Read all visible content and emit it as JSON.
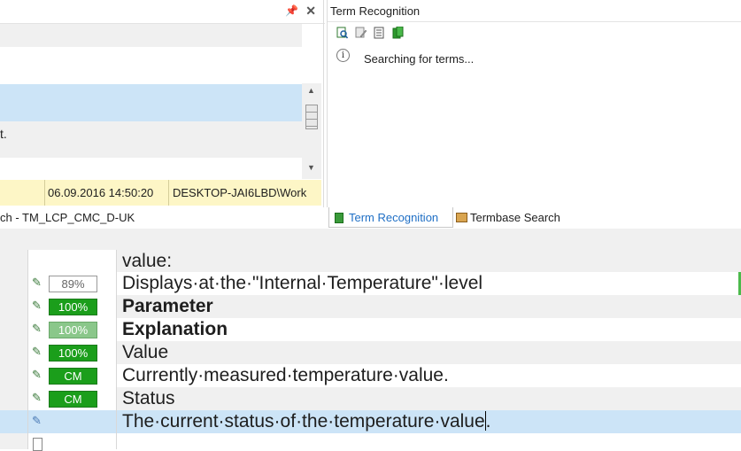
{
  "left_panel": {
    "pin_glyph": "📌",
    "close_glyph": "✕",
    "row_fragment": "t.",
    "status_row": {
      "date": "06.09.2016 14:50:20",
      "user": "DESKTOP-JAI6LBD\\Work"
    }
  },
  "term_recognition_panel": {
    "title": "Term Recognition",
    "toolbar_icons": [
      "search-term-icon",
      "edit-term-icon",
      "term-settings-icon",
      "termbase-icon"
    ],
    "info_glyph": "i",
    "message": "Searching for terms..."
  },
  "tabs": {
    "tm_label": "ch - TM_LCP_CMC_D-UK",
    "term_recognition": "Term Recognition",
    "termbase_search": "Termbase Search"
  },
  "editor": {
    "rows": [
      {
        "status": "",
        "target": "value:",
        "bold": false
      },
      {
        "status": "89%",
        "target": "Displays·at·the·\"Internal·Temperature\"·level",
        "bold": false
      },
      {
        "status": "100%",
        "target": "Parameter",
        "bold": true
      },
      {
        "status": "100%",
        "target": "Explanation",
        "bold": true
      },
      {
        "status": "100%",
        "target": "Value",
        "bold": false
      },
      {
        "status": "CM",
        "target": "Currently·measured·temperature·value.",
        "bold": false
      },
      {
        "status": "CM",
        "target": "Status",
        "bold": false
      },
      {
        "status": "",
        "target_before_caret": "The·current·status·of·the·temperature·value",
        "target_after_caret": ".",
        "bold": false
      }
    ]
  },
  "colors": {
    "match_green": "#1b9e1b",
    "selection_blue": "#cce4f7",
    "status_yellow": "#fdf6c6",
    "tab_active_text": "#1f6fc5"
  }
}
